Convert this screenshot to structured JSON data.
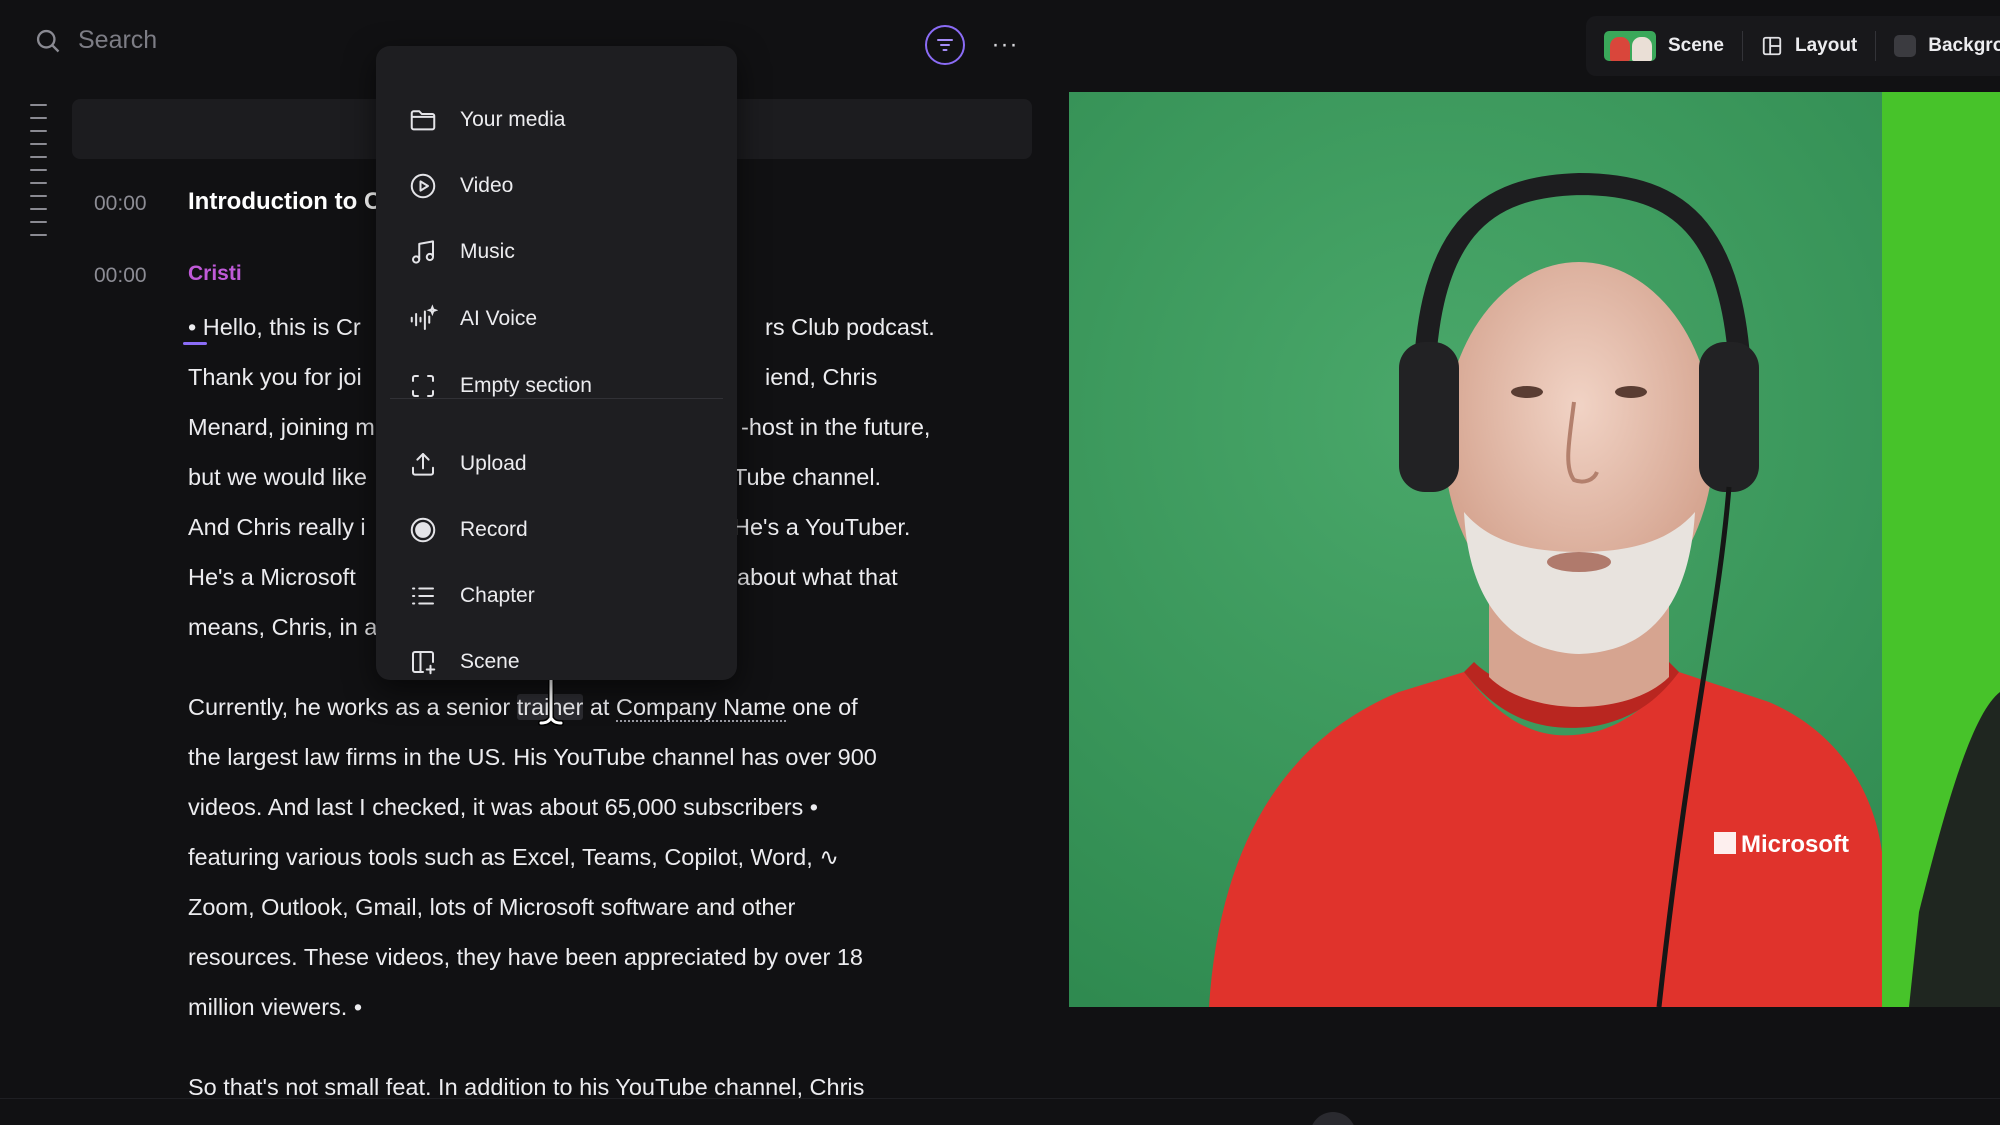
{
  "search": {
    "placeholder": "Search",
    "icon": "search-icon"
  },
  "toolbar": {
    "filter_icon": "filter-icon",
    "more_icon": "more-horizontal-icon",
    "more_label": "···"
  },
  "right_toolbar": {
    "scene_label": "Scene",
    "layout_label": "Layout",
    "background_label": "Backgro"
  },
  "transcript": {
    "chapter": {
      "time": "00:00",
      "title": "Introduction to C"
    },
    "speaker_block": {
      "time": "00:00",
      "speaker": "Cristi"
    },
    "para1": {
      "lines": [
        "• Hello, this is Cr",
        "rs Club podcast.",
        "Thank you for joi",
        "iend, Chris",
        "Menard, joining m",
        "-host in the future,",
        "but we would like",
        "Tube channel.",
        "And Chris really i",
        "He's a YouTuber.",
        "He's a Microsoft",
        "about what that",
        "means, Chris, in a"
      ]
    },
    "para2": {
      "line1_a": "Currently, he works as a senior ",
      "line1_cursor": "trainer",
      "line1_b": " at ",
      "line1_company": "Company Name",
      "line1_c": " one of",
      "line2": "the largest law firms in the US. His YouTube channel has over 900",
      "line3": "videos. And last I checked, it was about 65,000 subscribers •",
      "line4": "featuring various tools such as Excel, Teams, Copilot, Word, ∿",
      "line5": "Zoom, Outlook, Gmail, lots of Microsoft software and other",
      "line6": "resources. These videos, they have been appreciated by over 18",
      "line7": "million viewers. •"
    },
    "para3": {
      "line1": "So that's not small feat. In addition to his YouTube channel, Chris"
    }
  },
  "menu": {
    "items": [
      {
        "label": "Your media",
        "icon": "folder-icon"
      },
      {
        "label": "Video",
        "icon": "play-circle-icon"
      },
      {
        "label": "Music",
        "icon": "music-note-icon"
      },
      {
        "label": "AI Voice",
        "icon": "ai-voice-icon"
      },
      {
        "label": "Empty section",
        "icon": "empty-section-icon"
      },
      {
        "label": "Upload",
        "icon": "upload-icon"
      },
      {
        "label": "Record",
        "icon": "record-icon"
      },
      {
        "label": "Chapter",
        "icon": "chapter-list-icon"
      },
      {
        "label": "Scene",
        "icon": "scene-add-icon"
      }
    ]
  },
  "preview": {
    "shirt_logo": "Microsoft",
    "background_color": "#3f9c5e",
    "shirt_color": "#e0332c"
  },
  "colors": {
    "accent": "#8b6cf6",
    "speaker": "#c05ad8",
    "background": "#111113",
    "menu_bg": "#1e1e21"
  }
}
